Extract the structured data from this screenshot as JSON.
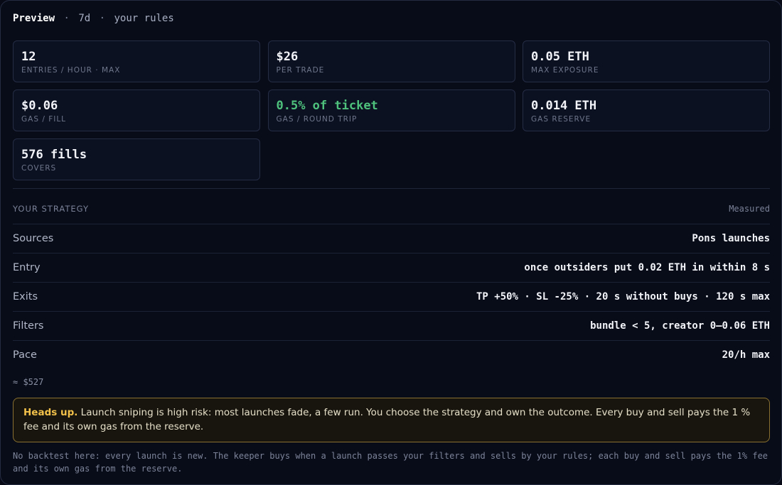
{
  "header": {
    "title": "Preview",
    "period": "7d",
    "scope": "your rules",
    "separator": "·"
  },
  "stats": [
    {
      "value": "12",
      "label": "ENTRIES / HOUR · MAX"
    },
    {
      "value": "$26",
      "label": "PER TRADE"
    },
    {
      "value": "0.05 ETH",
      "label": "MAX EXPOSURE"
    },
    {
      "value": "$0.06",
      "label": "GAS / FILL"
    },
    {
      "value": "0.5% of ticket",
      "label": "GAS / ROUND TRIP",
      "color": "#4ec27d"
    },
    {
      "value": "0.014 ETH",
      "label": "GAS RESERVE"
    },
    {
      "value": "576 fills",
      "label": "COVERS"
    }
  ],
  "strategy": {
    "heading": "YOUR STRATEGY",
    "status": "Measured",
    "rows": [
      {
        "key": "Sources",
        "value": "Pons launches"
      },
      {
        "key": "Entry",
        "value": "once outsiders put 0.02 ETH in within 8 s"
      },
      {
        "key": "Exits",
        "value": "TP +50% · SL -25% · 20 s without buys · 120 s max"
      },
      {
        "key": "Filters",
        "value": "bundle < 5, creator 0–0.06 ETH"
      },
      {
        "key": "Pace",
        "value": "20/h max"
      }
    ],
    "approx": "≈ $527"
  },
  "warning": {
    "strong": "Heads up.",
    "text": "Launch sniping is high risk: most launches fade, a few run. You choose the strategy and own the outcome. Every buy and sell pays the 1 % fee and its own gas from the reserve.",
    "border_color": "#8a7030",
    "accent_color": "#f2c14a"
  },
  "note": "No backtest here: every launch is new. The keeper buys when a launch passes your filters and sells by your rules; each buy and sell pays the 1% fee and its own gas from the reserve."
}
